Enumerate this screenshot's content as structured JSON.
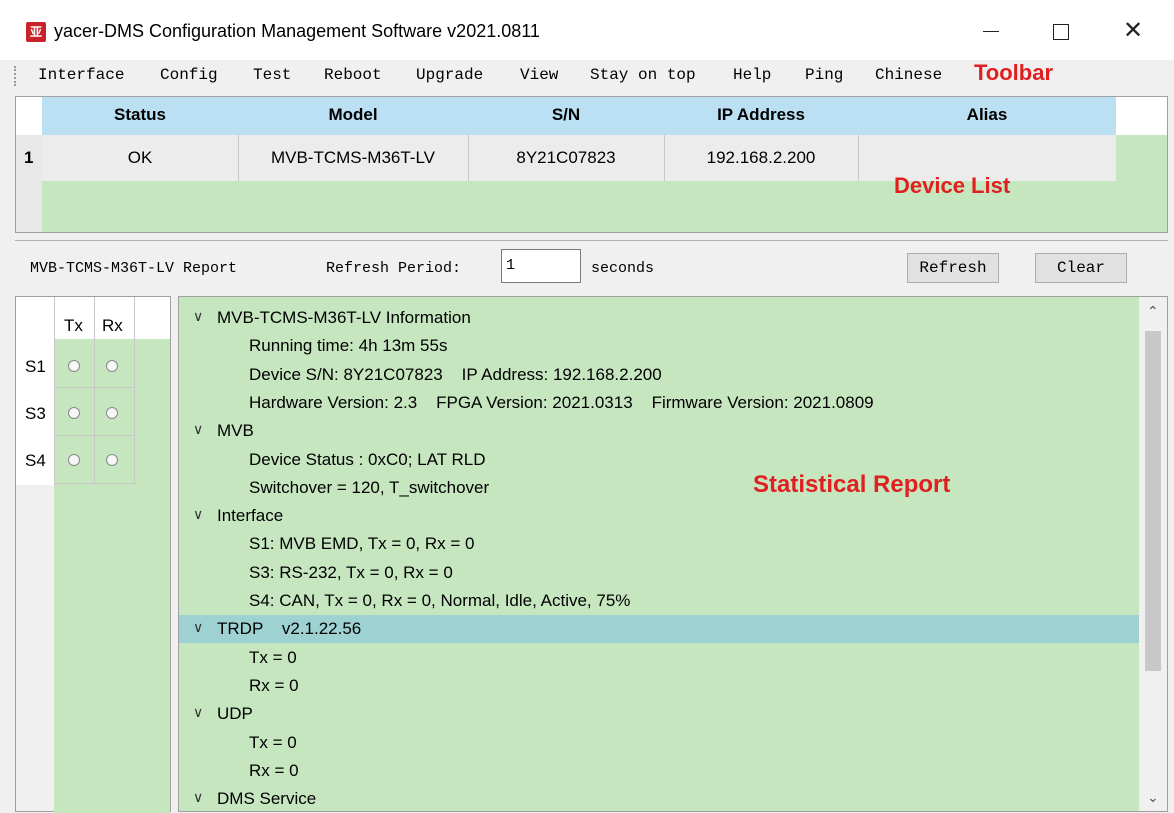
{
  "window": {
    "title": "yacer-DMS Configuration Management Software v2021.0811",
    "icon_text": "亚",
    "close_glyph": "✕"
  },
  "menu": {
    "items": [
      "Interface",
      "Config",
      "Test",
      "Reboot",
      "Upgrade",
      "View",
      "Stay on top",
      "Help",
      "Ping",
      "Chinese"
    ],
    "annotation": "Toolbar"
  },
  "device_list": {
    "columns": [
      "Status",
      "Model",
      "S/N",
      "IP Address",
      "Alias"
    ],
    "rows": [
      {
        "num": "1",
        "status": "OK",
        "model": "MVB-TCMS-M36T-LV",
        "sn": "8Y21C07823",
        "ip": "192.168.2.200",
        "alias": ""
      }
    ],
    "annotation": "Device List"
  },
  "report_bar": {
    "title": "MVB-TCMS-M36T-LV Report",
    "refresh_label": "Refresh Period:",
    "refresh_value": "1",
    "seconds_label": "seconds",
    "refresh_button": "Refresh",
    "clear_button": "Clear"
  },
  "ports": {
    "headers": [
      "Tx",
      "Rx"
    ],
    "rows": [
      "S1",
      "S3",
      "S4"
    ]
  },
  "report": {
    "annotation": "Statistical Report",
    "lines": [
      {
        "level": 0,
        "text": "MVB-TCMS-M36T-LV Information"
      },
      {
        "level": 1,
        "text": "Running time: 4h 13m 55s"
      },
      {
        "level": 1,
        "text": "Device S/N: 8Y21C07823    IP Address: 192.168.2.200"
      },
      {
        "level": 1,
        "text": "Hardware Version: 2.3    FPGA Version: 2021.0313    Firmware Version: 2021.0809"
      },
      {
        "level": 0,
        "text": "MVB"
      },
      {
        "level": 1,
        "text": "Device Status : 0xC0; LAT RLD"
      },
      {
        "level": 1,
        "text": "Switchover = 120, T_switchover"
      },
      {
        "level": 0,
        "text": "Interface"
      },
      {
        "level": 1,
        "text": "S1: MVB EMD, Tx = 0, Rx = 0"
      },
      {
        "level": 1,
        "text": "S3: RS-232, Tx = 0, Rx = 0"
      },
      {
        "level": 1,
        "text": "S4: CAN, Tx = 0, Rx = 0, Normal, Idle, Active, 75%"
      },
      {
        "level": 0,
        "text": "TRDP    v2.1.22.56",
        "selected": true
      },
      {
        "level": 1,
        "text": "Tx = 0"
      },
      {
        "level": 1,
        "text": "Rx = 0"
      },
      {
        "level": 0,
        "text": "UDP"
      },
      {
        "level": 1,
        "text": "Tx = 0"
      },
      {
        "level": 1,
        "text": "Rx = 0"
      },
      {
        "level": 0,
        "text": "DMS Service"
      }
    ]
  },
  "colors": {
    "panel_green": "#c6e6c0",
    "header_blue": "#bbe0f3",
    "selected_row": "#9ed2d2",
    "annotation_red": "#e02020",
    "icon_red": "#c8232b"
  }
}
